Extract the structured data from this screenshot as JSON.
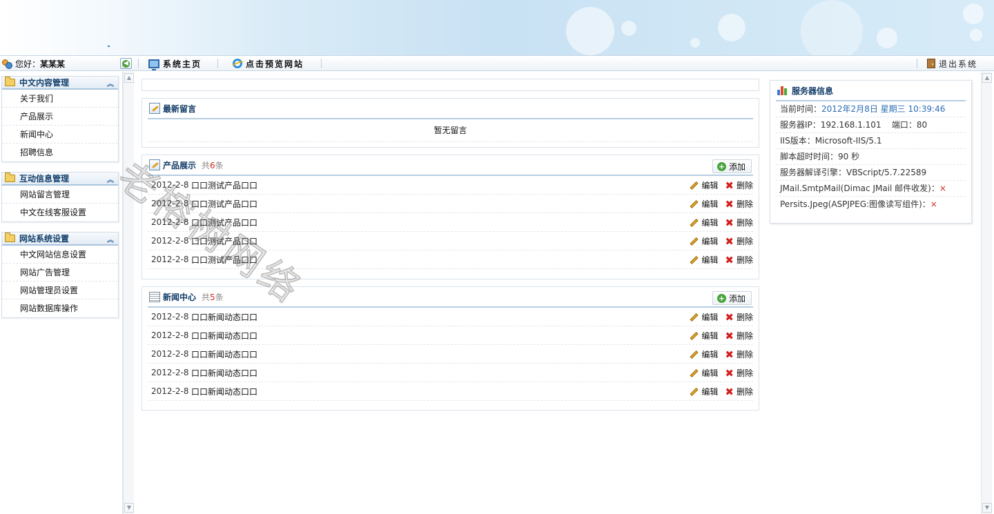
{
  "header": {
    "greeting": "您好：",
    "username": "某某某",
    "nav": [
      {
        "label": "系统主页"
      },
      {
        "label": "点击预览网站"
      }
    ],
    "logout_label": "退出系统"
  },
  "sidebar": {
    "groups": [
      {
        "title": "中文内容管理",
        "items": [
          "关于我们",
          "产品展示",
          "新闻中心",
          "招聘信息"
        ]
      },
      {
        "title": "互动信息管理",
        "items": [
          "网站留言管理",
          "中文在线客服设置"
        ]
      },
      {
        "title": "网站系统设置",
        "items": [
          "中文网站信息设置",
          "网站广告管理",
          "网站管理员设置",
          "网站数据库操作"
        ]
      }
    ]
  },
  "messages": {
    "title": "最新留言",
    "empty_text": "暂无留言"
  },
  "products": {
    "title": "产品展示",
    "count_prefix": "共",
    "count": "6",
    "count_suffix": "条",
    "add_label": "添加",
    "edit_label": "编辑",
    "delete_label": "删除",
    "rows": [
      {
        "date": "2012-2-8",
        "title": "口口测试产品口口"
      },
      {
        "date": "2012-2-8",
        "title": "口口测试产品口口"
      },
      {
        "date": "2012-2-8",
        "title": "口口测试产品口口"
      },
      {
        "date": "2012-2-8",
        "title": "口口测试产品口口"
      },
      {
        "date": "2012-2-8",
        "title": "口口测试产品口口"
      }
    ]
  },
  "news": {
    "title": "新闻中心",
    "count_prefix": "共",
    "count": "5",
    "count_suffix": "条",
    "add_label": "添加",
    "edit_label": "编辑",
    "delete_label": "删除",
    "rows": [
      {
        "date": "2012-2-8",
        "title": "口口新闻动态口口"
      },
      {
        "date": "2012-2-8",
        "title": "口口新闻动态口口"
      },
      {
        "date": "2012-2-8",
        "title": "口口新闻动态口口"
      },
      {
        "date": "2012-2-8",
        "title": "口口新闻动态口口"
      },
      {
        "date": "2012-2-8",
        "title": "口口新闻动态口口"
      }
    ]
  },
  "server": {
    "title": "服务器信息",
    "current_time_label": "当前时间：",
    "current_time": "2012年2月8日 星期三 10:39:46",
    "ip_label": "服务器IP：",
    "ip": "192.168.1.101",
    "port_label": "端口：",
    "port": "80",
    "iis_label": "IIS版本：",
    "iis": "Microsoft-IIS/5.1",
    "timeout_label": "脚本超时时间：",
    "timeout": "90 秒",
    "engine_label": "服务器解译引擎：",
    "engine": "VBScript/5.7.22589",
    "jmail_label": "JMail.SmtpMail(Dimac JMail 邮件收发)：",
    "jmail_status": "×",
    "jpeg_label": "Persits.Jpeg(ASPJPEG:图像读写组件)：",
    "jpeg_status": "×"
  },
  "watermark": "老榕树网络",
  "colors": {
    "accent": "#0f3a66",
    "count_red": "#d0281c",
    "link_blue": "#2b6cb4",
    "border": "#b7cde2"
  },
  "icons": [
    "user-icon",
    "back-arrow-icon",
    "monitor-icon",
    "ie-icon",
    "door-icon",
    "folder-icon",
    "chevron-up-icon",
    "note-icon",
    "news-icon",
    "plus-icon",
    "pencil-icon",
    "x-icon",
    "chart-icon"
  ]
}
